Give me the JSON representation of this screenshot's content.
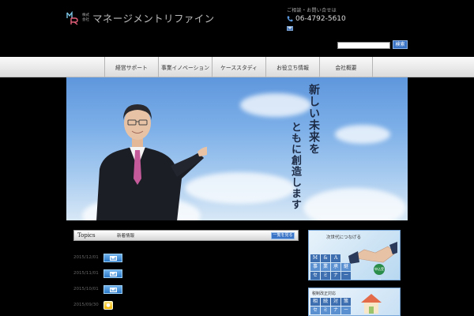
{
  "header": {
    "logo_small_1": "株式",
    "logo_small_2": "会社",
    "company_name": "マネージメントリファイン",
    "contact_label": "ご相談・お問い合せは",
    "phone": "06-4792-5610",
    "search_button": "検索"
  },
  "nav": {
    "items": [
      {
        "label": "経営サポート"
      },
      {
        "label": "事業イノベーション"
      },
      {
        "label": "ケーススタディ"
      },
      {
        "label": "お役立ち情報"
      },
      {
        "label": "会社概要"
      }
    ]
  },
  "hero": {
    "line1": "新しい未来を",
    "line2": "ともに創造します"
  },
  "topics": {
    "title": "Topics",
    "subtitle": "新着情報",
    "more": "一覧を見る",
    "items": [
      {
        "date": "2015/12/01",
        "icon": "mail-icon"
      },
      {
        "date": "2015/11/01",
        "icon": "mail-icon"
      },
      {
        "date": "2015/10/01",
        "icon": "mail-icon"
      },
      {
        "date": "2015/09/30",
        "icon": "bulb-icon"
      }
    ]
  },
  "banners": {
    "b1_top": "次世代につなげる",
    "b1_chars_row1": [
      "M",
      "&",
      "A",
      ""
    ],
    "b1_chars_row2": [
      "事",
      "業",
      "承",
      "継"
    ],
    "b1_chars_row3": [
      "セ",
      "ミ",
      "ナ",
      "ー"
    ],
    "b1_badge": "申込受付",
    "b2_top": "税制改正対応",
    "b2_chars_row1": [
      "相",
      "続",
      "対",
      "策"
    ],
    "b2_chars_row2": [
      "セ",
      "ミ",
      "ナ",
      "ー"
    ]
  },
  "colors": {
    "accent_blue": "#3a74c6",
    "background": "#000000",
    "sky": "#7cafe8"
  }
}
